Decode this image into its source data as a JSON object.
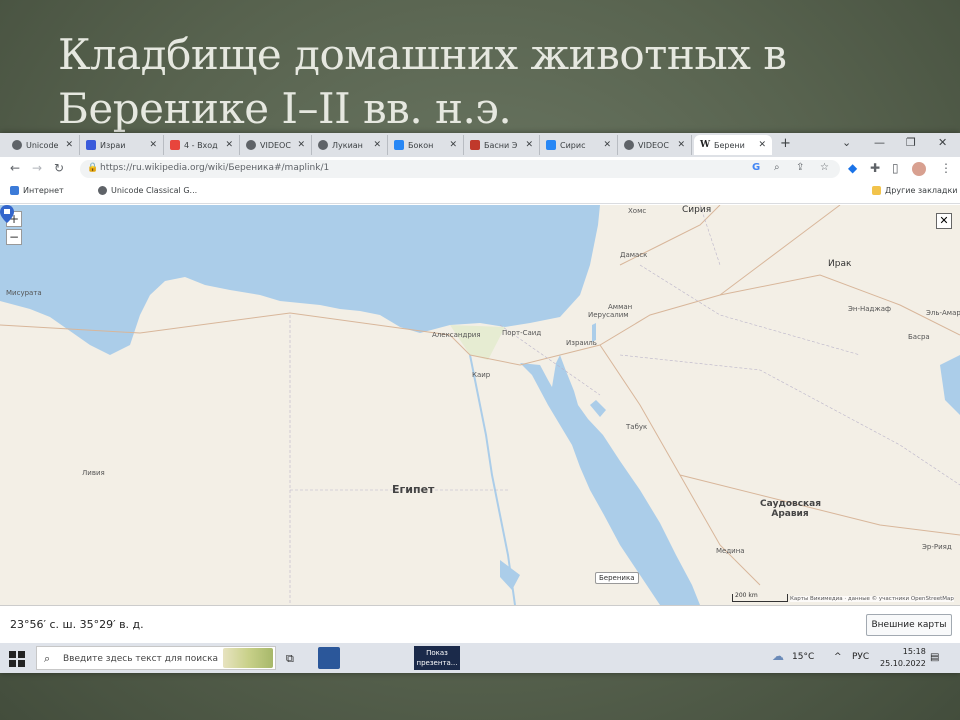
{
  "slide": {
    "title": "Кладбище домашних животных в Беренике I–II вв. н.э."
  },
  "browser": {
    "tabs": [
      {
        "label": "Unicode",
        "color": "#5f6368"
      },
      {
        "label": "Израи",
        "color": "#3b5bdb"
      },
      {
        "label": "4 - Вход",
        "color": "#e8453c"
      },
      {
        "label": "VIDEOC",
        "color": "#5f6368"
      },
      {
        "label": "Лукиан",
        "color": "#5f6368"
      },
      {
        "label": "Бокон",
        "color": "#2787f5"
      },
      {
        "label": "Басни Э",
        "color": "#c0392b"
      },
      {
        "label": "Сирис",
        "color": "#2787f5"
      },
      {
        "label": "VIDEOC",
        "color": "#5f6368"
      },
      {
        "label": "Берени",
        "color": "#202122"
      }
    ],
    "new_tab": "+",
    "window_controls": {
      "tabs_menu": "⌄",
      "minimize": "—",
      "restore": "❐",
      "close": "✕"
    },
    "url": "https://ru.wikipedia.org/wiki/Береникa#/maplink/1",
    "bookmarks": [
      {
        "label": "Интернет"
      },
      {
        "label": "Unicode Classical G..."
      }
    ],
    "other_bookmarks": "Другие закладки"
  },
  "map": {
    "zoom_in": "+",
    "zoom_out": "−",
    "close": "✕",
    "labels": {
      "homs": "Хомс",
      "syria": "Сирия",
      "damascus": "Дамаск",
      "iraq": "Ирак",
      "najaf": "Эн-Наджаф",
      "el_amara": "Эль-Амара",
      "basra": "Басра",
      "amman": "Амман",
      "jerusalem": "Иерусалим",
      "israel": "Израиль",
      "port_said": "Порт-Саид",
      "alexandria": "Александрия",
      "cairo": "Каир",
      "misrata": "Мисурата",
      "libya": "Ливия",
      "egypt": "Египет",
      "tabuk": "Табук",
      "saudi": "Саудовская Аравия",
      "medina": "Медина",
      "er_riyad": "Эр-Рияд"
    },
    "marker_label": "Береника",
    "scale": "200 km",
    "attribution": "Карты Викимедиа · данные © участники OpenStreetMap"
  },
  "coordinates": "23°56′ с. ш. 35°29′ в. д.",
  "external_maps": "Внешние карты",
  "taskbar": {
    "search_placeholder": "Введите здесь текст для поиска",
    "ppt_title": "Показ презента...",
    "weather": "15°C",
    "lang": "РУС",
    "time": "15:18",
    "date": "25.10.2022"
  }
}
